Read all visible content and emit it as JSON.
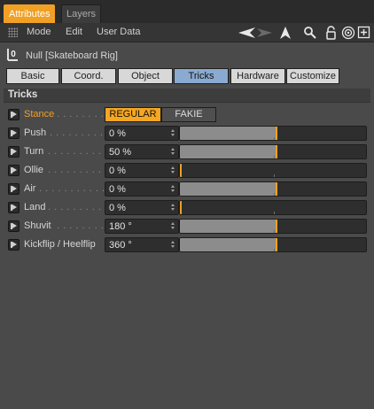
{
  "window": {
    "tabs": [
      {
        "label": "Attributes",
        "active": true
      },
      {
        "label": "Layers",
        "active": false
      }
    ]
  },
  "menubar": {
    "items": [
      "Mode",
      "Edit",
      "User Data"
    ],
    "tools": [
      "back-arrow-icon",
      "forward-arrow-icon",
      "pointer-up-icon",
      "search-icon",
      "lock-icon",
      "target-icon",
      "new-panel-icon"
    ]
  },
  "object": {
    "icon_glyph": "0",
    "title": "Null [Skateboard Rig]"
  },
  "subtabs": [
    {
      "label": "Basic",
      "active": false
    },
    {
      "label": "Coord.",
      "active": false
    },
    {
      "label": "Object",
      "active": false
    },
    {
      "label": "Tricks",
      "active": true
    },
    {
      "label": "Hardware",
      "active": false
    },
    {
      "label": "Customize",
      "active": false
    }
  ],
  "group": {
    "title": "Tricks",
    "stance": {
      "label": "Stance",
      "dots": ". . . . . . . .",
      "options": [
        "REGULAR",
        "FAKIE"
      ],
      "selected": "REGULAR"
    },
    "rows": [
      {
        "label": "Push",
        "dots": ". . . . . . . . . .",
        "value": "0 %",
        "fill_percent": 52
      },
      {
        "label": "Turn",
        "dots": ". . . . . . . . . .",
        "value": "50 %",
        "fill_percent": 52
      },
      {
        "label": "Ollie",
        "dots": ". . . . . . . . . .",
        "value": "0 %",
        "fill_percent": 0
      },
      {
        "label": "Air",
        "dots": ". . . . . . . . . . .",
        "value": "0 %",
        "fill_percent": 52
      },
      {
        "label": "Land",
        "dots": ". . . . . . . . . .",
        "value": "0 %",
        "fill_percent": 0
      },
      {
        "label": "Shuvit",
        "dots": ". . . . . . . . .",
        "value": "180 °",
        "fill_percent": 52
      },
      {
        "label": "Kickflip / Heelflip",
        "dots": "",
        "value": "360 °",
        "fill_percent": 52
      }
    ]
  },
  "colors": {
    "accent": "#f0a024",
    "active_subtab": "#8aaad0",
    "panel_bg": "#4a4a4a"
  }
}
